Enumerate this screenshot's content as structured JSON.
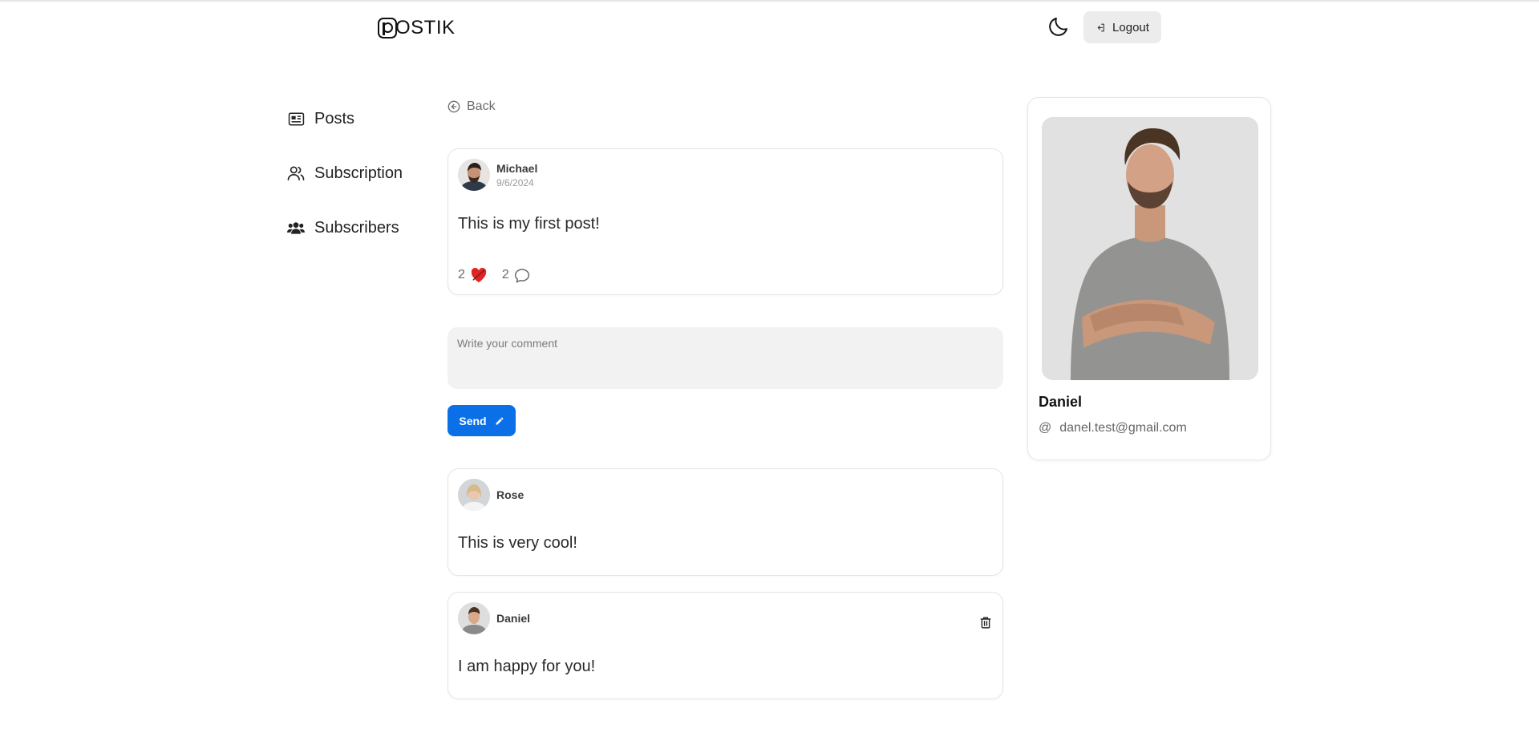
{
  "header": {
    "logo_text": "OSTIK",
    "logout_label": "Logout"
  },
  "sidebar": {
    "items": [
      {
        "label": "Posts",
        "icon": "newspaper-icon"
      },
      {
        "label": "Subscription",
        "icon": "users-outline-icon"
      },
      {
        "label": "Subscribers",
        "icon": "users-solid-icon"
      }
    ]
  },
  "main": {
    "back_label": "Back",
    "post": {
      "author": "Michael",
      "date": "9/6/2024",
      "text": "This is my first post!",
      "likes": "2",
      "comments": "2"
    },
    "comment_input": {
      "placeholder": "Write your comment",
      "value": ""
    },
    "send_label": "Send",
    "comments": [
      {
        "author": "Rose",
        "text": "This is very cool!"
      },
      {
        "author": "Daniel",
        "text": "I am happy for you!"
      }
    ]
  },
  "profile": {
    "name": "Daniel",
    "email": "danel.test@gmail.com",
    "at_symbol": "@"
  },
  "colors": {
    "accent": "#0b6fe8",
    "like": "#e02424"
  }
}
